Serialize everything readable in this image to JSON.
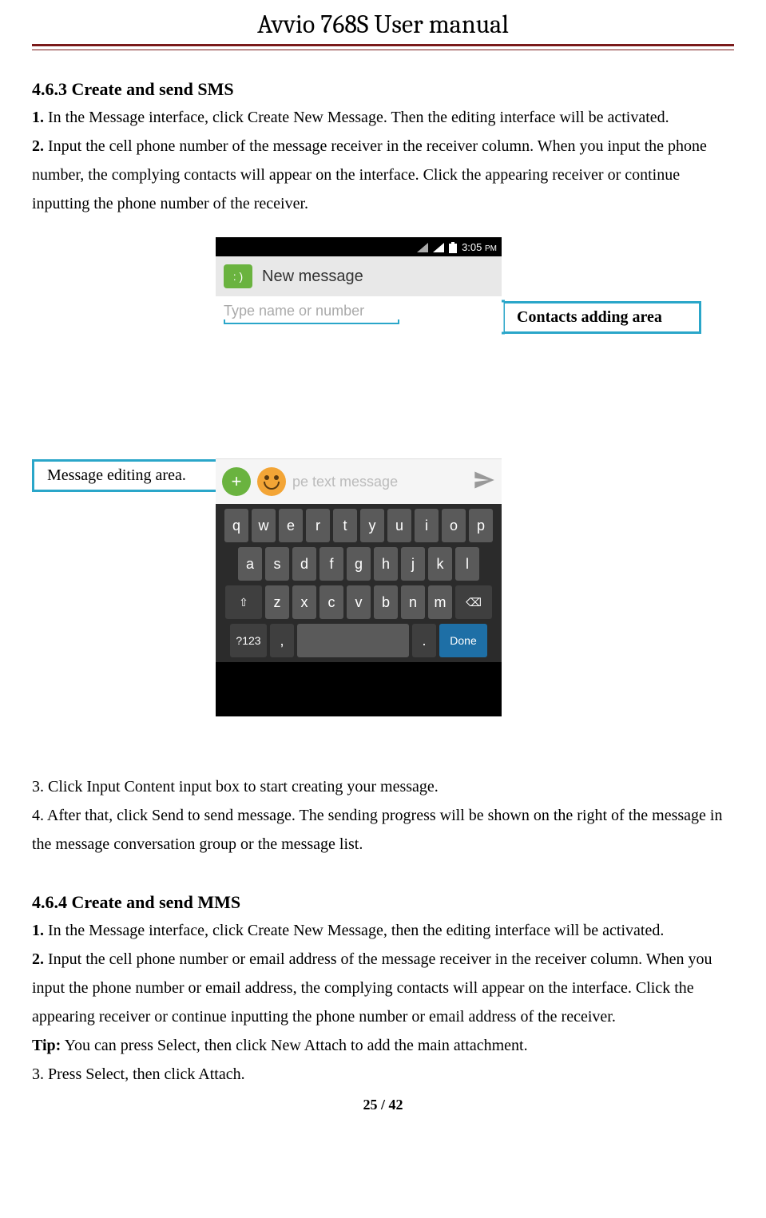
{
  "header": {
    "title": "Avvio 768S User manual"
  },
  "section1": {
    "title": "4.6.3 Create and send SMS",
    "step1_num": "1.",
    "step1_text": " In the Message interface, click Create New Message. Then the editing interface will be activated.",
    "step2_num": "2.",
    "step2_text": " Input the cell phone number of the message receiver in the receiver column. When you input the phone number, the complying contacts will appear on the interface. Click the appearing receiver or continue inputting the phone number of the receiver."
  },
  "callouts": {
    "left": "Message editing area.",
    "right": "Contacts adding area"
  },
  "phone": {
    "time": "3:05",
    "ampm": "PM",
    "app_title": "New message",
    "to_placeholder": "Type name or number",
    "compose_placeholder": "pe text message",
    "keyboard": {
      "row1": [
        "q",
        "w",
        "e",
        "r",
        "t",
        "y",
        "u",
        "i",
        "o",
        "p"
      ],
      "row2": [
        "a",
        "s",
        "d",
        "f",
        "g",
        "h",
        "j",
        "k",
        "l"
      ],
      "row3_shift": "⇧",
      "row3": [
        "z",
        "x",
        "c",
        "v",
        "b",
        "n",
        "m"
      ],
      "row3_del": "⌫",
      "row4_sym": "?123",
      "row4_comma": ",",
      "row4_space": "",
      "row4_dot": ".",
      "row4_done": "Done"
    }
  },
  "after_img": {
    "step3": "3. Click Input Content input box to start creating your message.",
    "step4": "4. After that, click Send to send message. The sending progress will be shown on the right of the message in the message conversation group or the message list."
  },
  "section2": {
    "title": "4.6.4 Create and send MMS",
    "step1_num": "1.",
    "step1_text": " In the Message interface, click Create New Message, then the editing interface will be activated.",
    "step2_num": "2.",
    "step2_text": " Input the cell phone number or email address of the message receiver in the receiver column. When you input the phone number or email address, the complying contacts will appear on the interface. Click the appearing receiver or continue inputting the phone number or email address of the receiver.",
    "tip_label": "Tip:",
    "tip_text": " You can press Select, then click New Attach to add the main attachment.",
    "step3": "3. Press Select, then click Attach."
  },
  "footer": {
    "page": "25 / 42"
  }
}
